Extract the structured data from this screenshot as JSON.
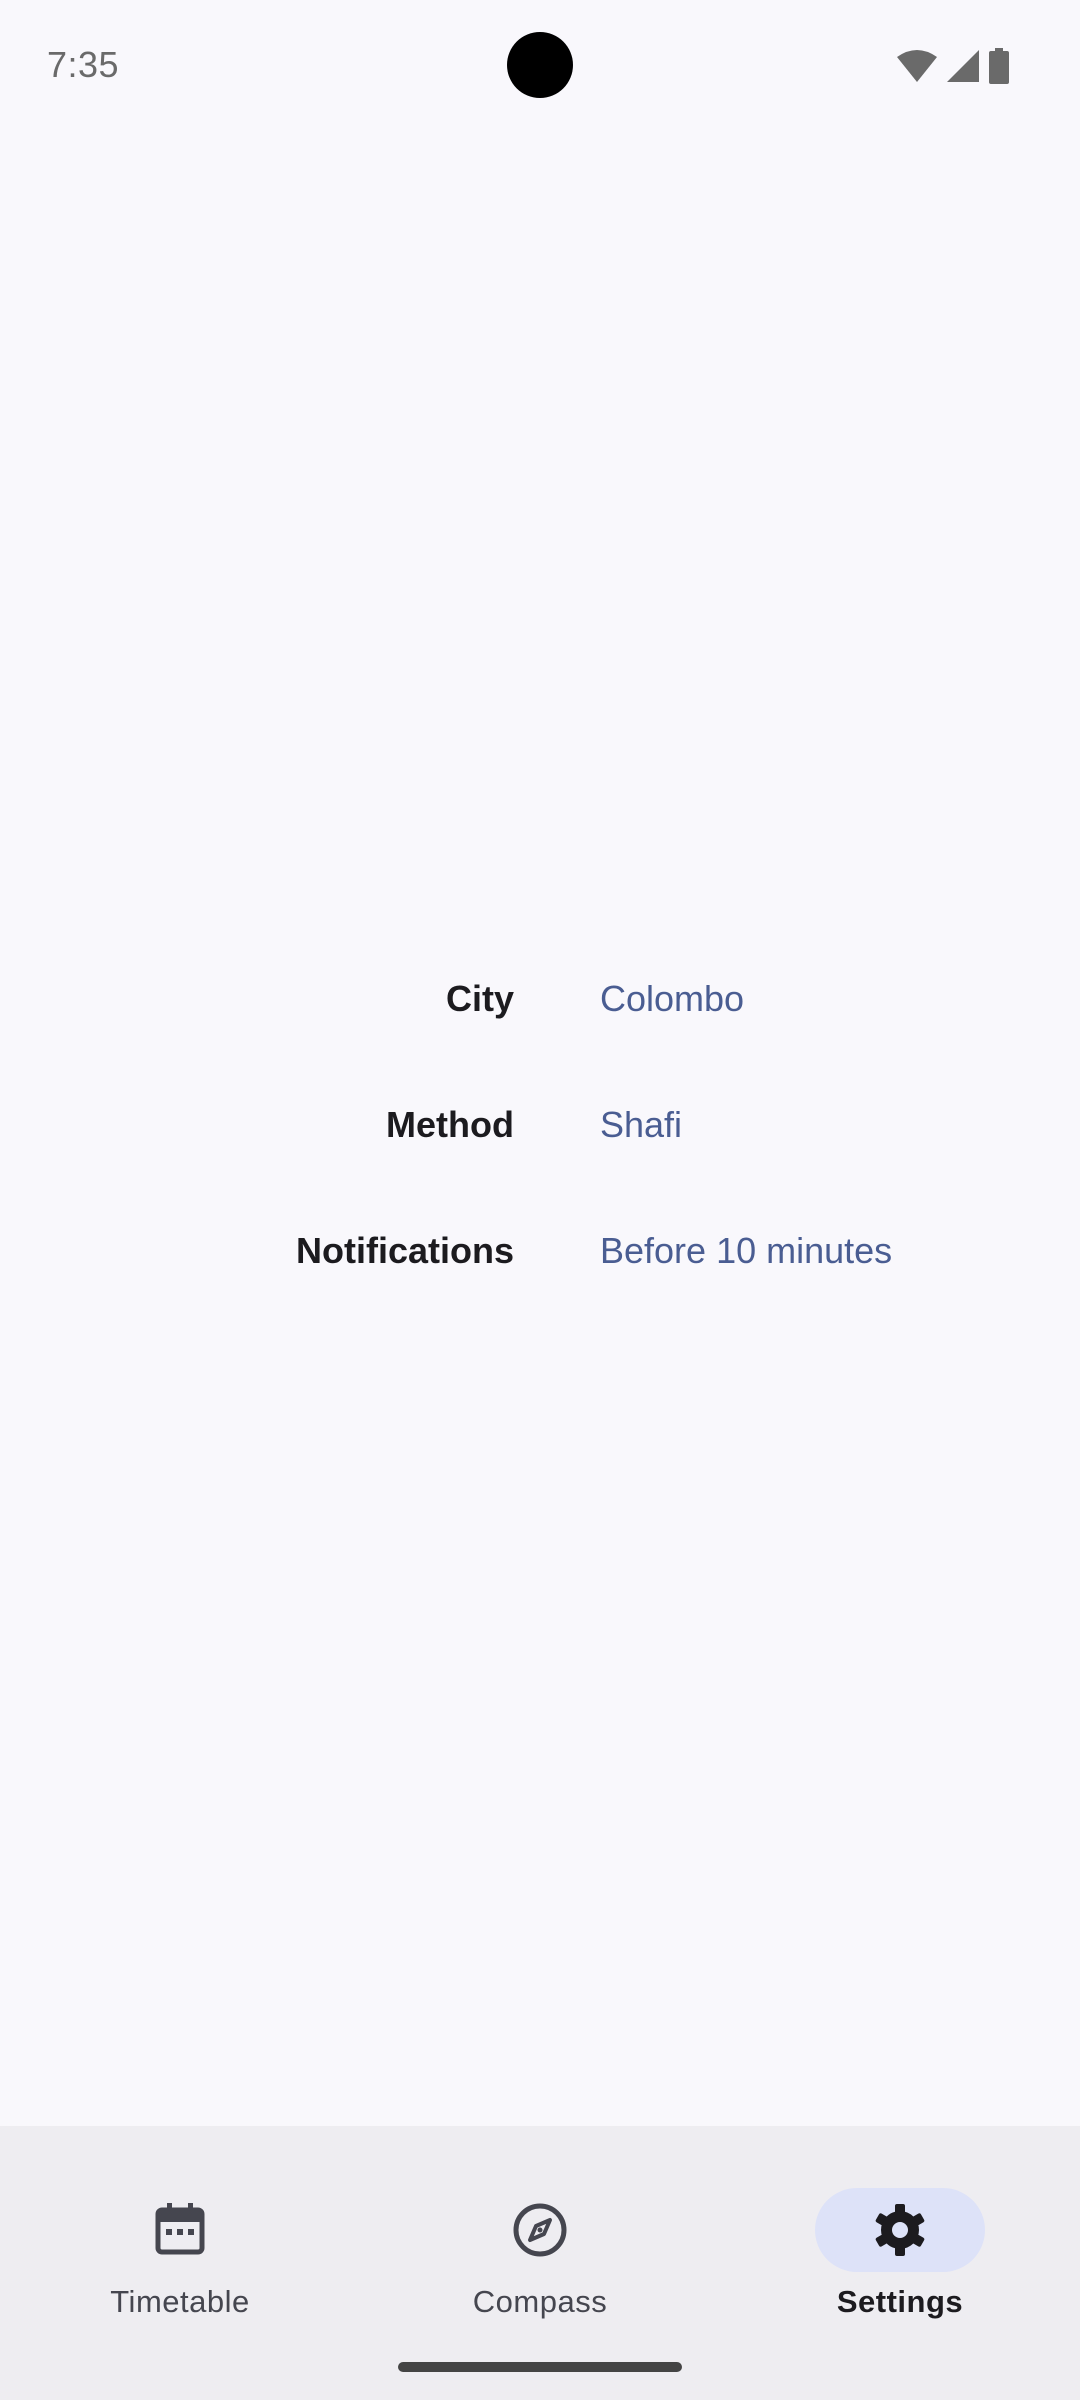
{
  "status_bar": {
    "time": "7:35",
    "icons": [
      "wifi-icon",
      "cellular-signal-icon",
      "battery-icon"
    ]
  },
  "settings": {
    "items": [
      {
        "label": "City",
        "value": "Colombo"
      },
      {
        "label": "Method",
        "value": "Shafi"
      },
      {
        "label": "Notifications",
        "value": "Before 10 minutes"
      }
    ]
  },
  "bottom_nav": {
    "items": [
      {
        "label": "Timetable",
        "icon": "calendar-icon",
        "active": false
      },
      {
        "label": "Compass",
        "icon": "compass-icon",
        "active": false
      },
      {
        "label": "Settings",
        "icon": "gear-icon",
        "active": true
      }
    ]
  },
  "colors": {
    "background": "#f9f8fc",
    "value_accent": "#4a5d92",
    "nav_background": "#eeedf1",
    "nav_active_indicator": "#dde2f8"
  }
}
